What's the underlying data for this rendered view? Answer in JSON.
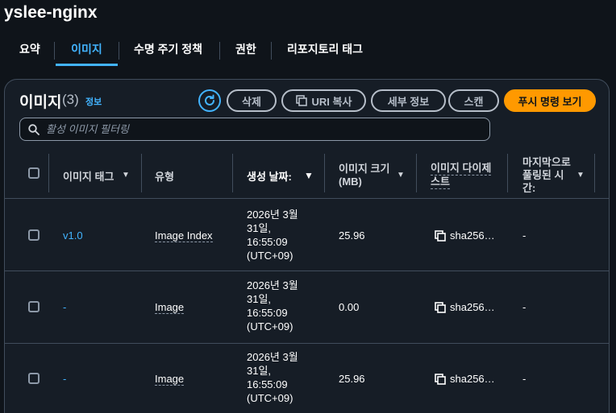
{
  "repo": {
    "title": "yslee-nginx"
  },
  "tabs": [
    {
      "label": "요약"
    },
    {
      "label": "이미지"
    },
    {
      "label": "수명 주기 정책"
    },
    {
      "label": "권한"
    },
    {
      "label": "리포지토리 태그"
    }
  ],
  "images_panel": {
    "title": "이미지",
    "count": "(3)",
    "info_link": "정보",
    "buttons": {
      "delete": "삭제",
      "copy_uri": "URI 복사",
      "details": "세부 정보",
      "scan": "스캔",
      "push_commands": "푸시 명령 보기"
    },
    "search": {
      "placeholder": "활성 이미지 필터링",
      "value": ""
    },
    "columns": {
      "tag": "이미지 태그",
      "type": "유형",
      "created": "생성 날짜:",
      "size_line1": "이미지 크기",
      "size_line2": "(MB)",
      "digest_line1": "이미지 다이제",
      "digest_line2": "스트",
      "pulled_line1": "마지막으로",
      "pulled_line2": "풀링된 시",
      "pulled_line3": "간:"
    },
    "rows": [
      {
        "tag": "v1.0",
        "type": "Image Index",
        "date_l1": "2026년 3월",
        "date_l2": "31일,",
        "date_l3": "16:55:09",
        "date_l4": "(UTC+09)",
        "size": "25.96",
        "digest": "sha256…",
        "last_pulled": "-"
      },
      {
        "tag": "-",
        "type": "Image",
        "date_l1": "2026년 3월",
        "date_l2": "31일,",
        "date_l3": "16:55:09",
        "date_l4": "(UTC+09)",
        "size": "0.00",
        "digest": "sha256…",
        "last_pulled": "-"
      },
      {
        "tag": "-",
        "type": "Image",
        "date_l1": "2026년 3월",
        "date_l2": "31일,",
        "date_l3": "16:55:09",
        "date_l4": "(UTC+09)",
        "size": "25.96",
        "digest": "sha256…",
        "last_pulled": "-"
      }
    ]
  },
  "colors": {
    "accent": "#42b4ff",
    "primary_button": "#ff9900",
    "background": "#0f141a",
    "panel": "#161d26"
  }
}
